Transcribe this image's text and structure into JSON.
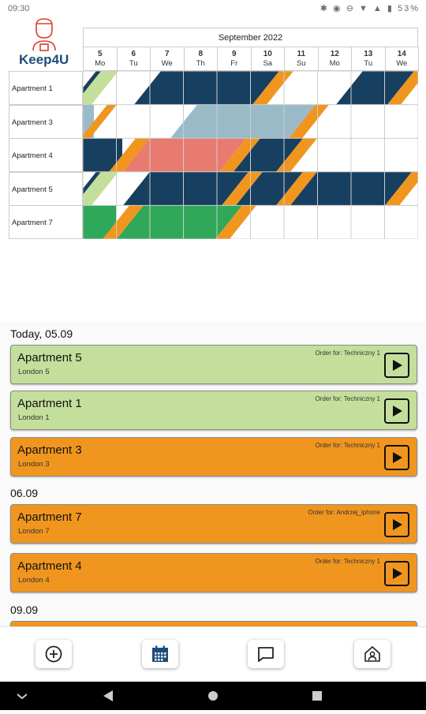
{
  "status": {
    "time": "09:30",
    "icons": "✱ ◉ ⊖ ▼ ▲ ▮ 53%"
  },
  "app": {
    "name": "Keep4U"
  },
  "calendar": {
    "month": "September 2022",
    "days": [
      {
        "num": "5",
        "wd": "Mo"
      },
      {
        "num": "6",
        "wd": "Tu"
      },
      {
        "num": "7",
        "wd": "We"
      },
      {
        "num": "8",
        "wd": "Th"
      },
      {
        "num": "9",
        "wd": "Fr"
      },
      {
        "num": "10",
        "wd": "Sa"
      },
      {
        "num": "11",
        "wd": "Su"
      },
      {
        "num": "12",
        "wd": "Mo"
      },
      {
        "num": "13",
        "wd": "Tu"
      },
      {
        "num": "14",
        "wd": "We"
      }
    ],
    "rows": [
      "Apartment 1",
      "Apartment 3",
      "Apartment 4",
      "Apartment 5",
      "Apartment 7"
    ],
    "colors": {
      "navy": "#173f60",
      "orange": "#f0961f",
      "lightgreen": "#c4df9b",
      "steel": "#9bbac8",
      "salmon": "#e97a70",
      "green": "#2fa85a"
    }
  },
  "list": {
    "groups": [
      {
        "title": "Today, 05.09",
        "items": [
          {
            "name": "Apartment 5",
            "city": "London 5",
            "order": "Order for: Techniczny 1",
            "color": "green"
          },
          {
            "name": "Apartment 1",
            "city": "London 1",
            "order": "Order for: Techniczny 1",
            "color": "green"
          },
          {
            "name": "Apartment 3",
            "city": "London 3",
            "order": "Order for: Techniczny 1",
            "color": "orange"
          }
        ]
      },
      {
        "title": "06.09",
        "items": [
          {
            "name": "Apartment 7",
            "city": "London 7",
            "order": "Order for: Andrzej_iphone",
            "color": "orange"
          },
          {
            "name": "Apartment 4",
            "city": "London 4",
            "order": "Order for: Techniczny 1",
            "color": "orange"
          }
        ]
      },
      {
        "title": "09.09",
        "items": []
      }
    ]
  },
  "bottom_nav": [
    {
      "name": "add-button",
      "icon": "plus-circle-icon"
    },
    {
      "name": "calendar-button",
      "icon": "calendar-icon"
    },
    {
      "name": "messages-button",
      "icon": "chat-icon"
    },
    {
      "name": "home-button",
      "icon": "house-user-icon"
    }
  ]
}
